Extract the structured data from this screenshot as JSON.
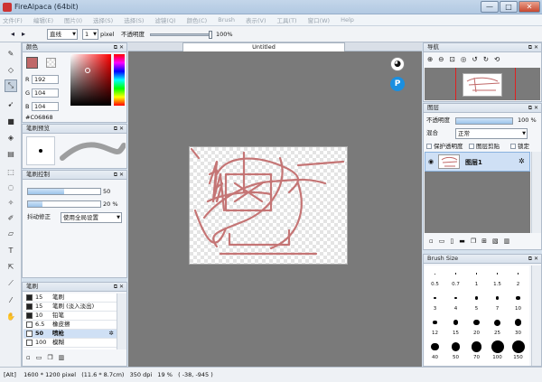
{
  "window": {
    "title": "FireAlpaca (64bit)",
    "min": "—",
    "max": "□",
    "close": "✕"
  },
  "menu": [
    "文件(F)",
    "编辑(E)",
    "图片(I)",
    "选择(S)",
    "选择(S)",
    "滤镜(Q)",
    "颜色(C)",
    "Brush",
    "表示(V)",
    "工具(T)",
    "窗口(W)",
    "Help"
  ],
  "toolbar": {
    "shape": "直线",
    "width": "1",
    "unit": "pixel",
    "opacity_label": "不透明度",
    "opacity": "100%",
    "opacity_value": 1.0
  },
  "tab": {
    "title": "Untitled"
  },
  "color_panel": {
    "title": "颜色",
    "r_label": "R",
    "r": "192",
    "g_label": "G",
    "g": "104",
    "b_label": "B",
    "b": "104",
    "hex": "#C06868",
    "fg_color": "#c06868"
  },
  "brush_preview": {
    "title": "笔刷预览"
  },
  "brush_control": {
    "title": "笔刷控制",
    "size": "50",
    "size_value": 0.5,
    "opacity": "20 %",
    "opacity_value": 0.2,
    "stab_label": "抖动修正",
    "stab_value": "使用全局设置"
  },
  "brush_panel": {
    "title": "笔刷",
    "rows": [
      {
        "size": "15",
        "name": "笔刷"
      },
      {
        "size": "15",
        "name": "笔刷 (淡入淡出)"
      },
      {
        "size": "10",
        "name": "铅笔"
      },
      {
        "size": "6.5",
        "name": "橡皮擦"
      },
      {
        "size": "50",
        "name": "喷枪"
      },
      {
        "size": "100",
        "name": "模糊"
      }
    ]
  },
  "navigator": {
    "title": "导航"
  },
  "layers": {
    "title": "图层",
    "opacity_label": "不透明度",
    "opacity": "100 %",
    "opacity_value": 1.0,
    "blend_label": "混合",
    "blend": "正常",
    "protect": "保护透明度",
    "clip": "图层剪贴",
    "lock": "锁定",
    "layer_name": "图层1"
  },
  "brush_size": {
    "title": "Brush Size",
    "sizes": [
      "0.5",
      "0.7",
      "1",
      "1.5",
      "2",
      "3",
      "4",
      "5",
      "7",
      "10",
      "12",
      "15",
      "20",
      "25",
      "30",
      "40",
      "50",
      "70",
      "100",
      "150"
    ]
  },
  "status": {
    "mode": "[Alt]",
    "size": "1600 * 1200 pixel",
    "dim": "(11.6 * 8.7cm)",
    "dpi": "350 dpi",
    "zoom": "19 %",
    "coords": "( -38, -945 )"
  }
}
